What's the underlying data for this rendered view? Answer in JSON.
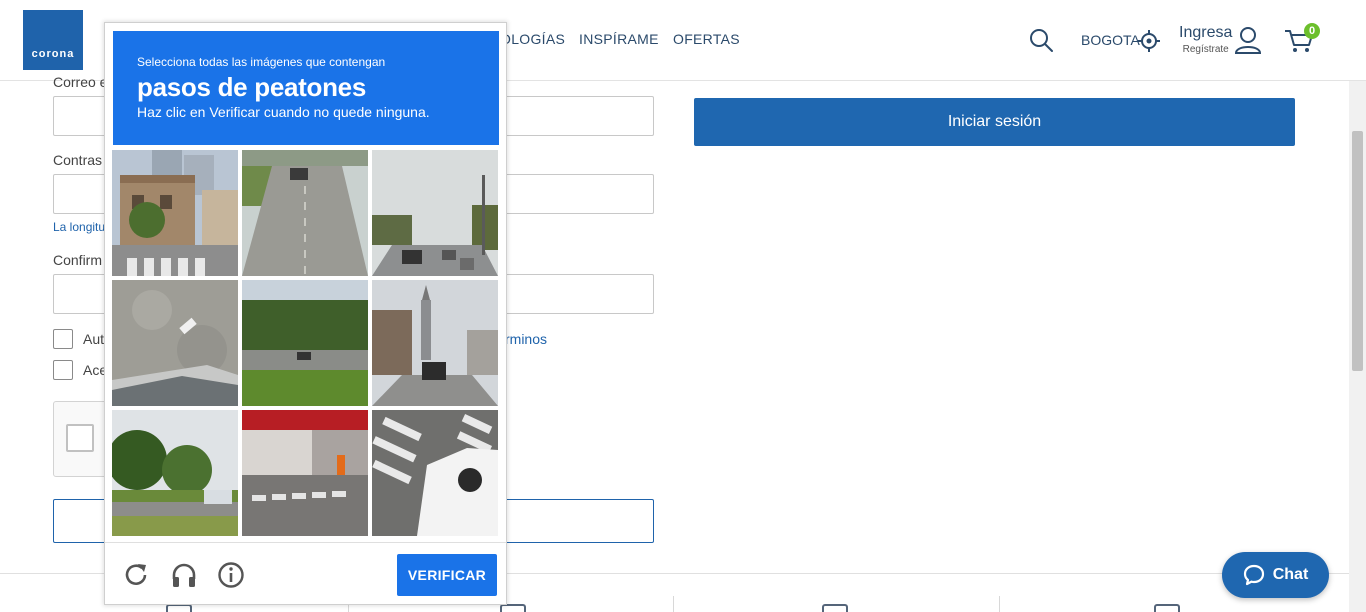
{
  "header": {
    "logo_text": "corona",
    "nav": [
      "OLOGÍAS",
      "INSPÍRAME",
      "OFERTAS"
    ],
    "city": "BOGOTA",
    "login_main": "Ingresa",
    "login_sub": "Regístrate",
    "cart_count": "0"
  },
  "form": {
    "label_email": "Correo e",
    "label_password": "Contras",
    "hint_password": "La longitu",
    "label_confirm": "Confirm",
    "check1_label": "Aut",
    "check2_label": "Ace",
    "terms_link": "rminos"
  },
  "login_button": "Iniciar sesión",
  "chat_button": "Chat",
  "challenge": {
    "line1": "Selecciona todas las imágenes que contengan",
    "line2": "pasos de peatones",
    "line3": "Haz clic en Verificar cuando no quede ninguna.",
    "verify_label": "VERIFICAR",
    "tiles": [
      "street-corner-building-crosswalk",
      "two-lane-road-cars",
      "highway-traffic-poles",
      "aerial-parking-car",
      "rural-road-trees",
      "town-street-church",
      "roadside-trees-car",
      "red-building-crosswalk",
      "crosswalk-white-car"
    ]
  },
  "colors": {
    "brand_blue": "#1f67b0",
    "captcha_blue": "#1a73e8",
    "badge_green": "#6cbf2c"
  }
}
